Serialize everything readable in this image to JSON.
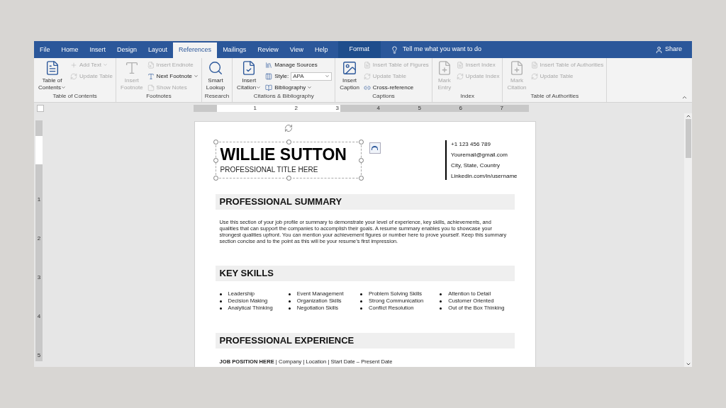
{
  "tabs": [
    {
      "label": "File",
      "kind": "tab",
      "selected": false
    },
    {
      "label": "Home",
      "kind": "tab",
      "selected": false
    },
    {
      "label": "Insert",
      "kind": "tab",
      "selected": false
    },
    {
      "label": "Design",
      "kind": "tab",
      "selected": false
    },
    {
      "label": "Layout",
      "kind": "tab",
      "selected": false
    },
    {
      "label": "References",
      "kind": "tab",
      "selected": true
    },
    {
      "label": "Mailings",
      "kind": "tab",
      "selected": false
    },
    {
      "label": "Review",
      "kind": "tab",
      "selected": false
    },
    {
      "label": "View",
      "kind": "tab",
      "selected": false
    },
    {
      "label": "Help",
      "kind": "tab",
      "selected": false
    },
    {
      "label": "Format",
      "kind": "contextual",
      "selected": false
    }
  ],
  "tell_me": "Tell me what you want to do",
  "share": "Share",
  "ribbon": [
    {
      "label": "Table of Contents",
      "columns": [
        {
          "kind": "large",
          "lines": [
            "Table of",
            "Contents"
          ],
          "dropdown": true,
          "disabled": false
        },
        {
          "kind": "stack",
          "items": [
            {
              "label": "Add Text",
              "dropdown": true,
              "disabled": true
            },
            {
              "label": "Update Table",
              "dropdown": false,
              "disabled": true
            }
          ]
        }
      ]
    },
    {
      "label": "Footnotes",
      "columns": [
        {
          "kind": "large",
          "lines": [
            "Insert",
            "Footnote"
          ],
          "dropdown": false,
          "disabled": true
        },
        {
          "kind": "stack",
          "items": [
            {
              "label": "Insert Endnote",
              "dropdown": false,
              "disabled": true
            },
            {
              "label": "Next Footnote",
              "dropdown": true,
              "disabled": false
            },
            {
              "label": "Show Notes",
              "dropdown": false,
              "disabled": true
            }
          ]
        }
      ]
    },
    {
      "label": "Research",
      "columns": [
        {
          "kind": "large",
          "lines": [
            "Smart",
            "Lookup"
          ],
          "dropdown": false,
          "disabled": false
        }
      ]
    },
    {
      "label": "Citations & Bibliography",
      "columns": [
        {
          "kind": "large",
          "lines": [
            "Insert",
            "Citation"
          ],
          "dropdown": true,
          "disabled": false
        },
        {
          "kind": "stack",
          "items": [
            {
              "label": "Manage Sources",
              "dropdown": false,
              "disabled": false
            },
            {
              "label": "Style:",
              "value": "APA",
              "dropdown": false,
              "disabled": false
            },
            {
              "label": "Bibliography",
              "dropdown": true,
              "disabled": false
            }
          ]
        }
      ]
    },
    {
      "label": "Captions",
      "columns": [
        {
          "kind": "large",
          "lines": [
            "Insert",
            "Caption"
          ],
          "dropdown": false,
          "disabled": false
        },
        {
          "kind": "stack",
          "items": [
            {
              "label": "Insert Table of Figures",
              "dropdown": false,
              "disabled": true
            },
            {
              "label": "Update Table",
              "dropdown": false,
              "disabled": true
            },
            {
              "label": "Cross-reference",
              "dropdown": false,
              "disabled": false
            }
          ]
        }
      ]
    },
    {
      "label": "Index",
      "columns": [
        {
          "kind": "large",
          "lines": [
            "Mark",
            "Entry"
          ],
          "dropdown": false,
          "disabled": true
        },
        {
          "kind": "stack",
          "items": [
            {
              "label": "Insert Index",
              "dropdown": false,
              "disabled": true
            },
            {
              "label": "Update Index",
              "dropdown": false,
              "disabled": true
            }
          ]
        }
      ]
    },
    {
      "label": "Table of Authorities",
      "columns": [
        {
          "kind": "large",
          "lines": [
            "Mark",
            "Citation"
          ],
          "dropdown": false,
          "disabled": true
        },
        {
          "kind": "stack",
          "items": [
            {
              "label": "Insert Table of Authorities",
              "dropdown": false,
              "disabled": true
            },
            {
              "label": "Update Table",
              "dropdown": false,
              "disabled": true
            }
          ]
        }
      ]
    }
  ],
  "ruler": [
    "1",
    "2",
    "3",
    "4",
    "5",
    "6",
    "7"
  ],
  "vertical_ruler": [
    "1",
    "2",
    "3",
    "4",
    "5"
  ],
  "resume": {
    "name": "WILLIE SUTTON",
    "title": "PROFESSIONAL TITLE HERE",
    "contact": [
      "+1 123 456 789",
      "Youremail@gmail.com",
      "City, State, Country",
      "Linkedin.com/in/username"
    ],
    "sections": [
      {
        "kind": "paragraph",
        "heading": "PROFESSIONAL SUMMARY",
        "text": "Use this section of your job profile or summary to demonstrate your level of experience, key skills, achievements, and qualities that can support the companies to accomplish their goals. A resume summary enables you to showcase your strongest qualities upfront. You can mention your achievement figures or number here to prove yourself. Keep this summary section concise and to the point as this will be your resume’s first impression."
      },
      {
        "kind": "skills",
        "heading": "KEY SKILLS",
        "columns": [
          [
            "Leadership",
            "Decision Making",
            "Analytical Thinking"
          ],
          [
            "Event Management",
            "Organization Skills",
            "Negotiation Skills"
          ],
          [
            "Problem Solving Skills",
            "Strong Communication",
            "Conflict Resolution"
          ],
          [
            "Attention to Detail",
            "Customer Oriented",
            "Out of the Box Thinking"
          ]
        ]
      },
      {
        "kind": "jobs",
        "heading": "PROFESSIONAL EXPERIENCE",
        "lines": [
          "**JOB POSITION HERE** | Company | Location | Start Date – Present Date"
        ]
      }
    ]
  }
}
